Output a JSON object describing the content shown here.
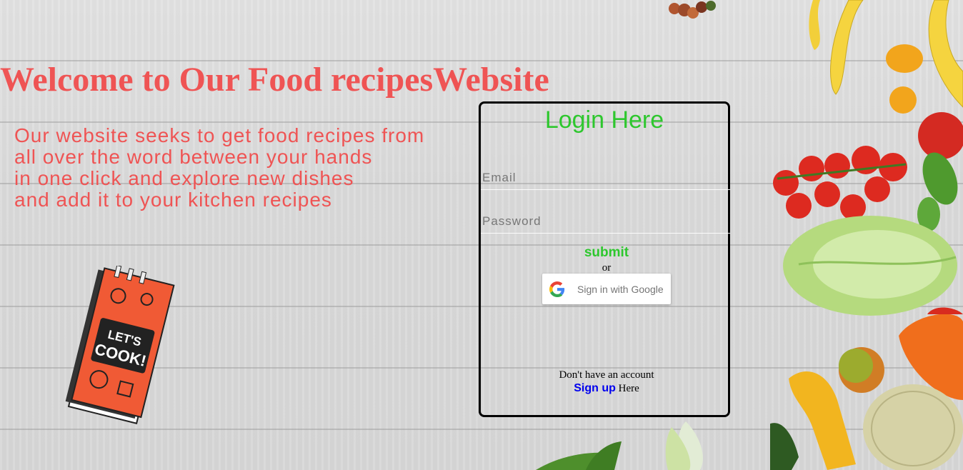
{
  "header": {
    "title": "Welcome to Our Food recipesWebsite"
  },
  "intro": {
    "lines": [
      "Our website seeks to get food recipes from",
      "all over the word between your hands",
      "in one click and explore new dishes",
      "and add it to your kitchen recipes"
    ]
  },
  "login": {
    "title": "Login Here",
    "email_placeholder": "Email",
    "password_placeholder": "Password",
    "submit_label": "submit",
    "or_label": "or",
    "google_label": "Sign in with Google",
    "no_account_text": "Don't have an account",
    "signup_label": "Sign up",
    "signup_suffix": " Here"
  },
  "decor": {
    "book_text_1": "LET'S",
    "book_text_2": "COOK!"
  },
  "colors": {
    "title": "#ef5454",
    "login_title": "#2ec72e",
    "link": "#0000ee"
  }
}
